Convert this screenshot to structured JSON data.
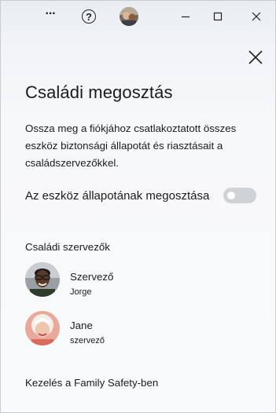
{
  "titlebar": {
    "more_icon": "more-horizontal-icon",
    "help_icon": "help-circle-icon",
    "minimize_icon": "minimize-icon",
    "maximize_icon": "maximize-icon",
    "close_icon": "close-icon",
    "more_glyph": "···",
    "help_glyph": "?"
  },
  "panel": {
    "close_icon": "close-icon",
    "title": "Családi megosztás",
    "description": "Ossza meg a fiókjához csatlakoztatott összes eszköz biztonsági állapotát és riasztásait a családszervezőkkel.",
    "toggle_label": "Az eszköz állapotának megosztása",
    "toggle_state": "off",
    "section_title": "Családi szervezők",
    "organizers": [
      {
        "name": "Szervező",
        "subtitle": "Jorge"
      },
      {
        "name": "Jane",
        "subtitle": "szervező"
      }
    ],
    "manage_link": "Kezelés a Family Safety-ben"
  },
  "colors": {
    "toggle_off_bg": "#cfd2d6",
    "text": "#1b1b1b"
  }
}
